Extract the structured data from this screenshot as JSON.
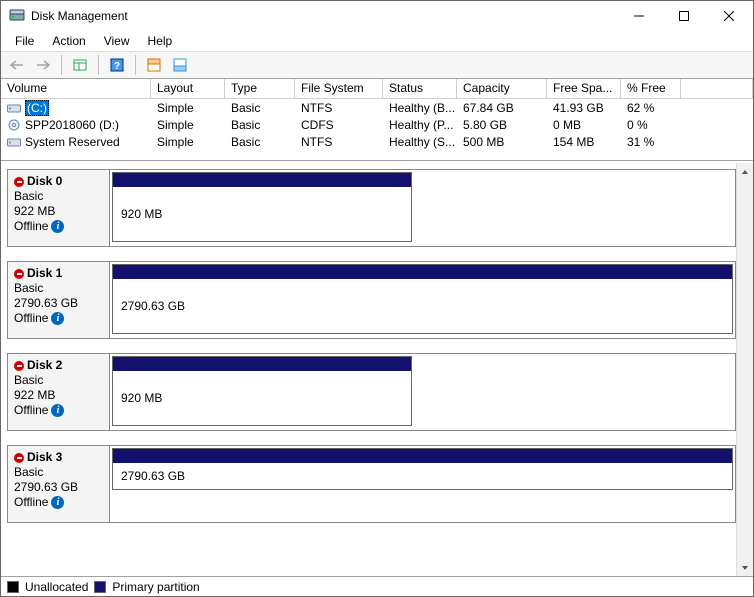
{
  "title": "Disk Management",
  "menu": {
    "file": "File",
    "action": "Action",
    "view": "View",
    "help": "Help"
  },
  "columns": [
    "Volume",
    "Layout",
    "Type",
    "File System",
    "Status",
    "Capacity",
    "Free Spa...",
    "% Free"
  ],
  "volumes": [
    {
      "icon": "drive",
      "name": "(C:)",
      "layout": "Simple",
      "type": "Basic",
      "fs": "NTFS",
      "status": "Healthy (B...",
      "capacity": "67.84 GB",
      "free": "41.93 GB",
      "pct": "62 %",
      "selected": true
    },
    {
      "icon": "cd",
      "name": "SPP2018060 (D:)",
      "layout": "Simple",
      "type": "Basic",
      "fs": "CDFS",
      "status": "Healthy (P...",
      "capacity": "5.80 GB",
      "free": "0 MB",
      "pct": "0 %",
      "selected": false
    },
    {
      "icon": "drive",
      "name": "System Reserved",
      "layout": "Simple",
      "type": "Basic",
      "fs": "NTFS",
      "status": "Healthy (S...",
      "capacity": "500 MB",
      "free": "154 MB",
      "pct": "31 %",
      "selected": false
    }
  ],
  "disks": [
    {
      "name": "Disk 0",
      "type": "Basic",
      "size": "922 MB",
      "status": "Offline",
      "part_label": "920 MB",
      "full": false
    },
    {
      "name": "Disk 1",
      "type": "Basic",
      "size": "2790.63 GB",
      "status": "Offline",
      "part_label": "2790.63 GB",
      "full": true
    },
    {
      "name": "Disk 2",
      "type": "Basic",
      "size": "922 MB",
      "status": "Offline",
      "part_label": "920 MB",
      "full": false
    },
    {
      "name": "Disk 3",
      "type": "Basic",
      "size": "2790.63 GB",
      "status": "Offline",
      "part_label": "2790.63 GB",
      "full": true
    }
  ],
  "legend": {
    "unallocated": "Unallocated",
    "primary": "Primary partition"
  },
  "colors": {
    "primary": "#12126e",
    "unallocated": "#000000"
  }
}
